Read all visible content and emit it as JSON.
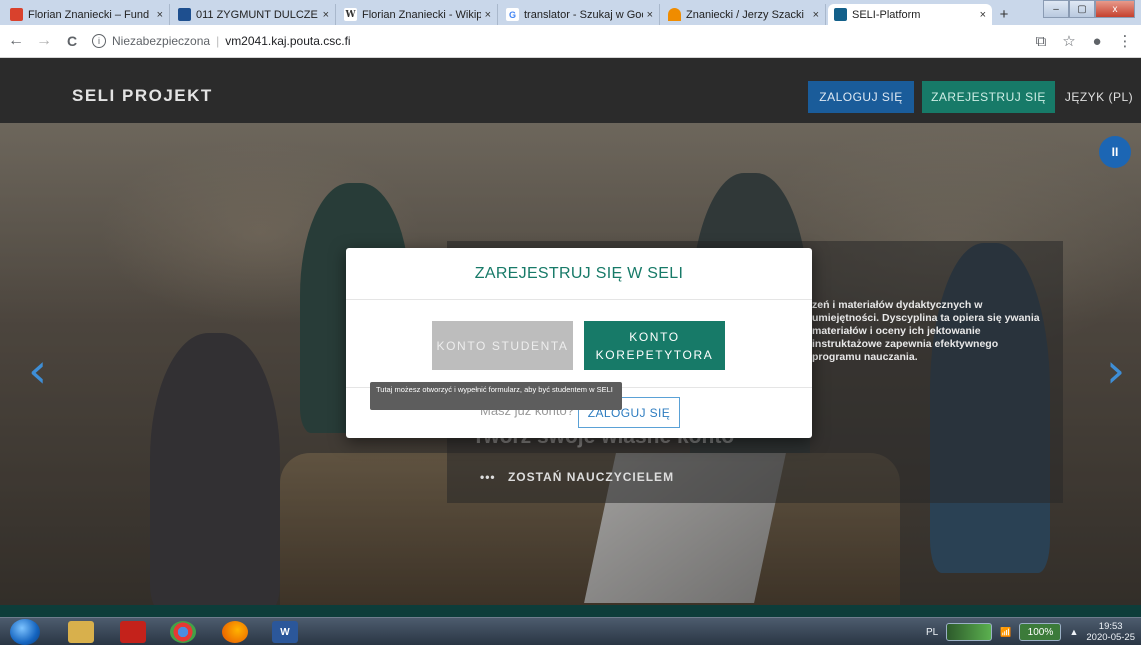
{
  "browser": {
    "tabs": [
      {
        "title": "Florian Znaniecki – Fund",
        "favicon_color": "#d9412c"
      },
      {
        "title": "011 ZYGMUNT DULCZE",
        "favicon_color": "#1e4f8f"
      },
      {
        "title": "Florian Znaniecki - Wikip",
        "favicon_glyph": "W",
        "favicon_color": "#ffffff"
      },
      {
        "title": "translator - Szukaj w Goo",
        "favicon_glyph": "G",
        "favicon_color": "#ffffff"
      },
      {
        "title": "Znaniecki / Jerzy Szacki",
        "favicon_color": "#f08c00"
      },
      {
        "title": "SELI-Platform",
        "favicon_color": "#13608a"
      }
    ],
    "active_tab_index": 5,
    "tab_close_glyph": "×",
    "new_tab_glyph": "+",
    "security_label": "Niezabezpieczona",
    "separator": "|",
    "url": "vm2041.kaj.pouta.csc.fi",
    "nav": {
      "back": "←",
      "forward": "→",
      "reload": "C",
      "info": "i"
    },
    "right_icons": {
      "translate": "⧉",
      "bookmark": "☆",
      "profile": "●",
      "menu": "⋮"
    },
    "window_controls": {
      "minimize": "–",
      "maximize": "▢",
      "close": "x"
    }
  },
  "site": {
    "brand": "SELI PROJEKT",
    "header": {
      "login": "ZALOGUJ SIĘ",
      "register": "ZAREJESTRUJ SIĘ",
      "language": "JĘZYK (PL)"
    }
  },
  "hero": {
    "caption_text": "zeń i materiałów dydaktycznych w umiejętności. Dyscyplina ta opiera się ywania materiałów i oceny ich jektowanie instruktażowe zapewnia efektywnego programu nauczania.",
    "caption_title": "Twórz swoje własne konto",
    "cta_dots": "•••",
    "cta": "ZOSTAŃ NAUCZYCIELEM",
    "prev_glyph": "‹",
    "next_glyph": "›",
    "pause_glyph": "II"
  },
  "modal": {
    "title": "ZAREJESTRUJ SIĘ W SELI",
    "student_button": "KONTO STUDENTA",
    "tutor_button": "KONTO KOREPETYTORA",
    "have_account": "Masz już konto?",
    "login_button": "ZALOGUJ SIĘ",
    "tooltip": "Tutaj możesz otworzyć i wypełnić formularz, aby być studentem w SELI"
  },
  "taskbar": {
    "apps": [
      {
        "name": "explorer-icon",
        "color": "#d8b04c"
      },
      {
        "name": "acrobat-icon",
        "color": "#c4221b"
      },
      {
        "name": "chrome-icon",
        "color": "#3b8f3b"
      },
      {
        "name": "firefox-icon",
        "color": "#e66b10"
      },
      {
        "name": "word-icon",
        "glyph": "W",
        "color": "#2b579a"
      }
    ],
    "lang": "PL",
    "battery": "100%",
    "tray_arrow": "▲",
    "time": "19:53",
    "date": "2020-05-25"
  },
  "colors": {
    "accent_teal": "#177a68",
    "accent_blue": "#1a5c9a",
    "carousel_arrow": "#3e8ed6"
  }
}
